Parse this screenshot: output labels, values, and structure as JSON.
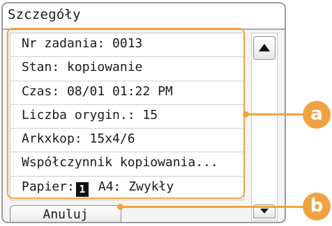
{
  "header": {
    "title": "Szczegóły"
  },
  "details": {
    "rows": [
      "Nr zadania: 0013",
      "Stan: kopiowanie",
      "Czas: 08/01 01:22 PM",
      "Liczba orygin.: 15",
      "Arkxkop: 15x4/6",
      "Współczynnik kopiowania..."
    ],
    "paper": {
      "label": "Papier:",
      "icon_text": "1",
      "value": "A4: Zwykły"
    }
  },
  "footer": {
    "cancel_label": "Anuluj"
  },
  "callouts": {
    "a": "a",
    "b": "b"
  },
  "colors": {
    "accent": "#f2a23f",
    "frame": "#9a9a9a"
  },
  "icons": {
    "scroll_up": "triangle-up-icon",
    "scroll_down": "triangle-down-icon"
  }
}
